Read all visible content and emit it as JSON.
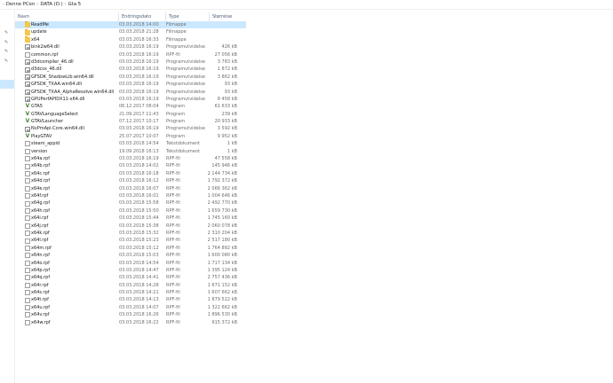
{
  "breadcrumb": {
    "items": [
      "Denne PCen",
      "DATA (D:)",
      "Gta 5"
    ]
  },
  "columns": {
    "name": "Navn",
    "date": "Endringsdato",
    "type": "Type",
    "size": "Størrelse"
  },
  "files": [
    {
      "name": "ReadMe",
      "date": "03.03.2018 14:00",
      "type": "Filmappe",
      "size": "",
      "icon": "folder-icon",
      "selected": true
    },
    {
      "name": "update",
      "date": "03.03.2018 21:28",
      "type": "Filmappe",
      "size": "",
      "icon": "folder-icon"
    },
    {
      "name": "x64",
      "date": "03.03.2018 16:33",
      "type": "Filmappe",
      "size": "",
      "icon": "folder-icon"
    },
    {
      "name": "bink2w64.dll",
      "date": "03.03.2018 16:19",
      "type": "Programutvidelse",
      "size": "426 kB",
      "icon": "dll-icon"
    },
    {
      "name": "common.rpf",
      "date": "03.03.2018 16:19",
      "type": "RPF-fil",
      "size": "27 056 kB",
      "icon": "file-icon"
    },
    {
      "name": "d3dcompiler_46.dll",
      "date": "03.03.2018 16:19",
      "type": "Programutvidelse",
      "size": "3 783 kB",
      "icon": "dll-icon"
    },
    {
      "name": "d3dcsx_46.dll",
      "date": "03.03.2018 16:19",
      "type": "Programutvidelse",
      "size": "1 872 kB",
      "icon": "dll-icon"
    },
    {
      "name": "GFSDK_ShadowLib.win64.dll",
      "date": "03.03.2018 16:19",
      "type": "Programutvidelse",
      "size": "3 862 kB",
      "icon": "dll-icon"
    },
    {
      "name": "GFSDK_TXAA.win64.dll",
      "date": "03.03.2018 16:19",
      "type": "Programutvidelse",
      "size": "93 kB",
      "icon": "dll-icon"
    },
    {
      "name": "GFSDK_TXAA_AlphaResolve.win64.dll",
      "date": "03.03.2018 16:19",
      "type": "Programutvidelse",
      "size": "93 kB",
      "icon": "dll-icon"
    },
    {
      "name": "GPUPerfAPIDX11-x64.dll",
      "date": "03.03.2018 16:19",
      "type": "Programutvidelse",
      "size": "8 458 kB",
      "icon": "dll-icon"
    },
    {
      "name": "GTA5",
      "date": "06.12.2017 08:04",
      "type": "Program",
      "size": "61 633 kB",
      "icon": "gtav-icon"
    },
    {
      "name": "GTAVLanguageSelect",
      "date": "21.09.2017 11:43",
      "type": "Program",
      "size": "239 kB",
      "icon": "gtav-icon"
    },
    {
      "name": "GTAVLauncher",
      "date": "07.12.2017 10:17",
      "type": "Program",
      "size": "20 933 kB",
      "icon": "gtav-icon"
    },
    {
      "name": "NvPmApi.Core.win64.dll",
      "date": "03.03.2018 16:19",
      "type": "Programutvidelse",
      "size": "3 592 kB",
      "icon": "dll-icon"
    },
    {
      "name": "PlayGTAV",
      "date": "25.07.2017 10:07",
      "type": "Program",
      "size": "9 952 kB",
      "icon": "gtav-icon"
    },
    {
      "name": "steam_appid",
      "date": "03.03.2018 14:54",
      "type": "Tekstdokument",
      "size": "1 kB",
      "icon": "file-icon"
    },
    {
      "name": "version",
      "date": "19.09.2018 16:13",
      "type": "Tekstdokument",
      "size": "1 kB",
      "icon": "file-icon"
    },
    {
      "name": "x64a.rpf",
      "date": "03.03.2018 16:19",
      "type": "RPF-fil",
      "size": "47 558 kB",
      "icon": "file-icon"
    },
    {
      "name": "x64b.rpf",
      "date": "03.03.2018 14:02",
      "type": "RPF-fil",
      "size": "145 946 kB",
      "icon": "file-icon"
    },
    {
      "name": "x64c.rpf",
      "date": "03.03.2018 16:18",
      "type": "RPF-fil",
      "size": "2 144 734 kB",
      "icon": "file-icon"
    },
    {
      "name": "x64d.rpf",
      "date": "03.03.2018 16:12",
      "type": "RPF-fil",
      "size": "1 792 372 kB",
      "icon": "file-icon"
    },
    {
      "name": "x64e.rpf",
      "date": "03.03.2018 16:07",
      "type": "RPF-fil",
      "size": "2 066 362 kB",
      "icon": "file-icon"
    },
    {
      "name": "x64f.rpf",
      "date": "03.03.2018 16:01",
      "type": "RPF-fil",
      "size": "1 004 646 kB",
      "icon": "file-icon"
    },
    {
      "name": "x64g.rpf",
      "date": "03.03.2018 15:58",
      "type": "RPF-fil",
      "size": "2 492 770 kB",
      "icon": "file-icon"
    },
    {
      "name": "x64h.rpf",
      "date": "03.03.2018 15:50",
      "type": "RPF-fil",
      "size": "1 659 730 kB",
      "icon": "file-icon"
    },
    {
      "name": "x64i.rpf",
      "date": "03.03.2018 15:44",
      "type": "RPF-fil",
      "size": "1 745 160 kB",
      "icon": "file-icon"
    },
    {
      "name": "x64j.rpf",
      "date": "03.03.2018 15:38",
      "type": "RPF-fil",
      "size": "2 060 078 kB",
      "icon": "file-icon"
    },
    {
      "name": "x64k.rpf",
      "date": "03.03.2018 15:32",
      "type": "RPF-fil",
      "size": "2 310 204 kB",
      "icon": "file-icon"
    },
    {
      "name": "x64l.rpf",
      "date": "03.03.2018 15:23",
      "type": "RPF-fil",
      "size": "2 517 180 kB",
      "icon": "file-icon"
    },
    {
      "name": "x64m.rpf",
      "date": "03.03.2018 15:12",
      "type": "RPF-fil",
      "size": "1 764 892 kB",
      "icon": "file-icon"
    },
    {
      "name": "x64n.rpf",
      "date": "03.03.2018 15:03",
      "type": "RPF-fil",
      "size": "1 600 080 kB",
      "icon": "file-icon"
    },
    {
      "name": "x64o.rpf",
      "date": "03.03.2018 14:54",
      "type": "RPF-fil",
      "size": "1 717 134 kB",
      "icon": "file-icon"
    },
    {
      "name": "x64p.rpf",
      "date": "03.03.2018 14:47",
      "type": "RPF-fil",
      "size": "1 395 124 kB",
      "icon": "file-icon"
    },
    {
      "name": "x64q.rpf",
      "date": "03.03.2018 14:41",
      "type": "RPF-fil",
      "size": "2 757 436 kB",
      "icon": "file-icon"
    },
    {
      "name": "x64r.rpf",
      "date": "03.03.2018 14:28",
      "type": "RPF-fil",
      "size": "1 671 152 kB",
      "icon": "file-icon"
    },
    {
      "name": "x64s.rpf",
      "date": "03.03.2018 14:21",
      "type": "RPF-fil",
      "size": "1 607 662 kB",
      "icon": "file-icon"
    },
    {
      "name": "x64t.rpf",
      "date": "03.03.2018 14:13",
      "type": "RPF-fil",
      "size": "1 879 522 kB",
      "icon": "file-icon"
    },
    {
      "name": "x64u.rpf",
      "date": "03.03.2018 14:07",
      "type": "RPF-fil",
      "size": "1 322 662 kB",
      "icon": "file-icon"
    },
    {
      "name": "x64v.rpf",
      "date": "03.03.2018 16:26",
      "type": "RPF-fil",
      "size": "1 896 530 kB",
      "icon": "file-icon"
    },
    {
      "name": "x64w.rpf",
      "date": "03.03.2018 16:22",
      "type": "RPF-fil",
      "size": "915 372 kB",
      "icon": "file-icon"
    }
  ],
  "colors": {
    "selection": "#cce8ff",
    "folder": "#f4c74d",
    "header_text": "#4c607a",
    "secondary_text": "#6d6d6d"
  }
}
